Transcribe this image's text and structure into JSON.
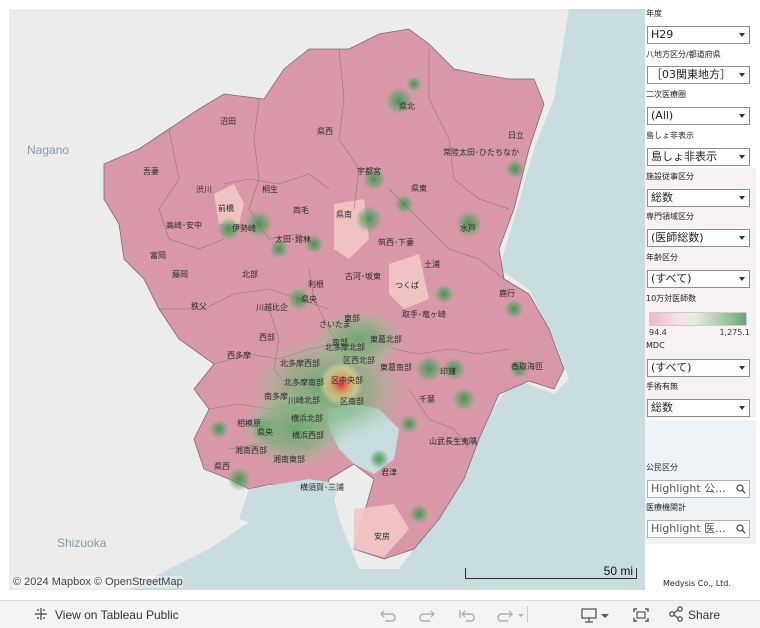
{
  "map": {
    "attribution": "© 2024 Mapbox  © OpenStreetMap",
    "scale_label": "50 mi",
    "geo_labels": {
      "nagano": "Nagano",
      "shizuoka": "Shizuoka"
    },
    "region_labels": {
      "numata": "沼田",
      "agatsuma": "吾妻",
      "kensei": "県西",
      "kenpoku": "県北",
      "hitachi": "日立",
      "hitachiota": "常陸太田･ひたちなか",
      "utsunomiya": "宇都宮",
      "kento": "県東",
      "shibukawa": "渋川",
      "kiryu": "桐生",
      "ryomo": "両毛",
      "kennan": "県南",
      "maebashi": "前橋",
      "takasaki": "高崎･安中",
      "isesaki": "伊勢崎",
      "tomioka": "富岡",
      "ota": "太田･館林",
      "fujioka": "藤岡",
      "chikusei": "筑西･下妻",
      "mito": "水戸",
      "koga": "古河･坂東",
      "tsuchiura": "土浦",
      "tsukuba": "つくば",
      "kashima": "鹿行",
      "hokubu": "北部",
      "tone": "利根",
      "kenou": "県央",
      "chichibu": "秩父",
      "kawagoe": "川越比企",
      "saitama": "さいたま",
      "tobu": "東部",
      "nanbu": "南部",
      "toride": "取手･竜ヶ崎",
      "nishitama": "西多摩",
      "seibu": "西部",
      "kitatamanishi": "北多摩西部",
      "kitatamakita": "北多摩北部",
      "minamitama": "南多摩",
      "kitatamanan": "北多摩南部",
      "kubuhoku": "区西北部",
      "tohokubu": "東葛北部",
      "tonanbu": "東葛南部",
      "chubu": "区中央部",
      "inba": "印旛",
      "katori": "香取海匝",
      "sagamihara": "相模原",
      "kawasakihoku": "川崎北部",
      "kunanbu": "区南部",
      "chiba": "千葉",
      "kenhoku": "県央",
      "yokohamahoku": "横浜北部",
      "yokohamanishi": "横浜西部",
      "sanbu": "山武長生夷隅",
      "shonanwest": "湘南西部",
      "shonaneast": "湘南東部",
      "kensei2": "県西",
      "yokosuka": "横須賀･三浦",
      "kimitsu": "君津",
      "awa": "安房"
    }
  },
  "filters": {
    "year": {
      "label": "年度",
      "value": "H29"
    },
    "region": {
      "label": "八地方区分/都道府県",
      "value": "［03関東地方］"
    },
    "secondary": {
      "label": "二次医療圏",
      "value": "(All)"
    },
    "island": {
      "label": "島しょ非表示",
      "value": "島しょ非表示"
    },
    "facility": {
      "label": "施設従事区分",
      "value": "総数"
    },
    "specialty": {
      "label": "専門領域区分",
      "value": "(医師総数)"
    },
    "age": {
      "label": "年齢区分",
      "value": "(すべて)"
    },
    "legend": {
      "label": "10万対医師数",
      "min": "94.4",
      "max": "1,275.1"
    },
    "mdc": {
      "label": "MDC",
      "value": "(すべて)"
    },
    "surgery": {
      "label": "手術有無",
      "value": "総数"
    },
    "public": {
      "label": "公民区分",
      "placeholder": "Highlight 公..."
    },
    "hospital": {
      "label": "医療機関計",
      "placeholder": "Highlight 医..."
    }
  },
  "company": "Medysis Co., Ltd.",
  "toolbar": {
    "view_label": "View on Tableau Public",
    "share_label": "Share"
  },
  "colors": {
    "region_fill": "#d898a8",
    "region_fill_light": "#f3c6c7",
    "hotspot_green": "#4f9a5a",
    "hotspot_red": "#d03a4a",
    "water": "#c9dcdf",
    "land": "#ececec"
  }
}
